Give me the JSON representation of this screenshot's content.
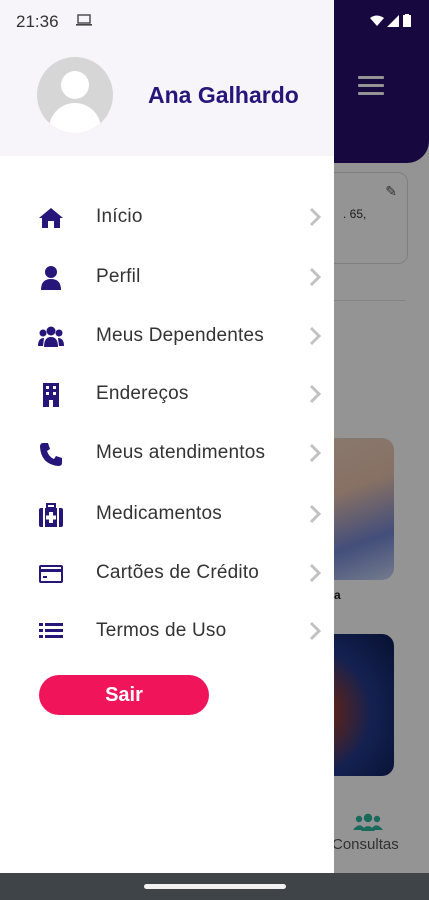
{
  "status_bar": {
    "time": "21:36"
  },
  "drawer": {
    "user_name": "Ana Galhardo",
    "menu_items": [
      {
        "label": "Início",
        "icon": "home-icon"
      },
      {
        "label": "Perfil",
        "icon": "person-icon"
      },
      {
        "label": "Meus Dependentes",
        "icon": "group-icon"
      },
      {
        "label": "Endereços",
        "icon": "building-icon"
      },
      {
        "label": "Meus atendimentos",
        "icon": "phone-icon"
      },
      {
        "label": "Medicamentos",
        "icon": "medkit-icon"
      },
      {
        "label": "Cartões de Crédito",
        "icon": "credit-card-icon"
      },
      {
        "label": "Termos de Uso",
        "icon": "list-icon"
      }
    ],
    "logout_label": "Sair"
  },
  "background": {
    "card_text": ". 65,",
    "tile_label": "a",
    "bottom_nav_label": "Consultas"
  },
  "colors": {
    "accent": "#26167a",
    "header": "#2a0f6e",
    "logout": "#f0145b",
    "bottom_nav_active": "#2bb5a0"
  }
}
